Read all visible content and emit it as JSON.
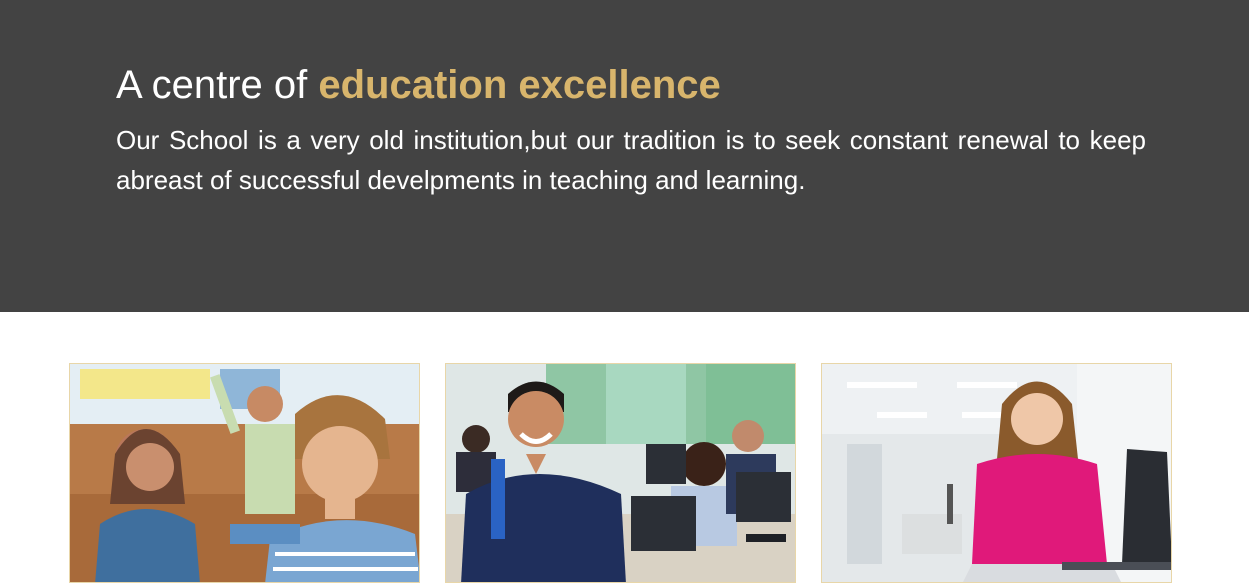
{
  "hero": {
    "title_plain": "A centre of ",
    "title_accent": "education excellence",
    "description": "Our School is a very old institution,but our tradition is to seek constant renewal to keep abreast of successful develpments in teaching and learning."
  },
  "colors": {
    "hero_background": "#434343",
    "accent": "#d8b56c",
    "card_border": "#e8d6a8"
  },
  "cards": [
    {
      "image": "classroom-children-photo"
    },
    {
      "image": "student-computer-lab-photo"
    },
    {
      "image": "student-laptop-library-photo"
    }
  ]
}
